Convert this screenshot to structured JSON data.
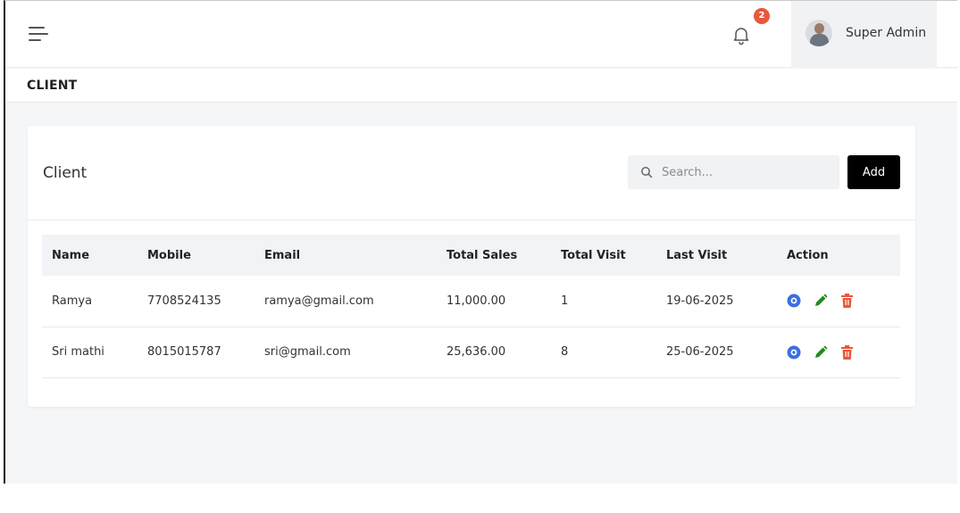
{
  "header": {
    "notification_count": "2",
    "user_name": "Super Admin"
  },
  "section": {
    "title": "CLIENT"
  },
  "card": {
    "title": "Client",
    "search_placeholder": "Search...",
    "add_label": "Add"
  },
  "table": {
    "headers": [
      "Name",
      "Mobile",
      "Email",
      "Total Sales",
      "Total Visit",
      "Last Visit",
      "Action"
    ],
    "rows": [
      {
        "name": "Ramya",
        "mobile": "7708524135",
        "email": "ramya@gmail.com",
        "total_sales": "11,000.00",
        "total_visit": "1",
        "last_visit": "19-06-2025"
      },
      {
        "name": "Sri mathi",
        "mobile": "8015015787",
        "email": "sri@gmail.com",
        "total_sales": "25,636.00",
        "total_visit": "8",
        "last_visit": "25-06-2025"
      }
    ]
  },
  "icons": {
    "menu": "menu-icon",
    "notification": "bell-icon",
    "search": "search-icon",
    "view": "eye-icon",
    "edit": "pencil-icon",
    "delete": "trash-icon"
  },
  "colors": {
    "badge": "#e8573c",
    "view": "#3b6fe0",
    "edit": "#1f8a1f",
    "delete": "#e8573c",
    "add_button": "#000000"
  }
}
